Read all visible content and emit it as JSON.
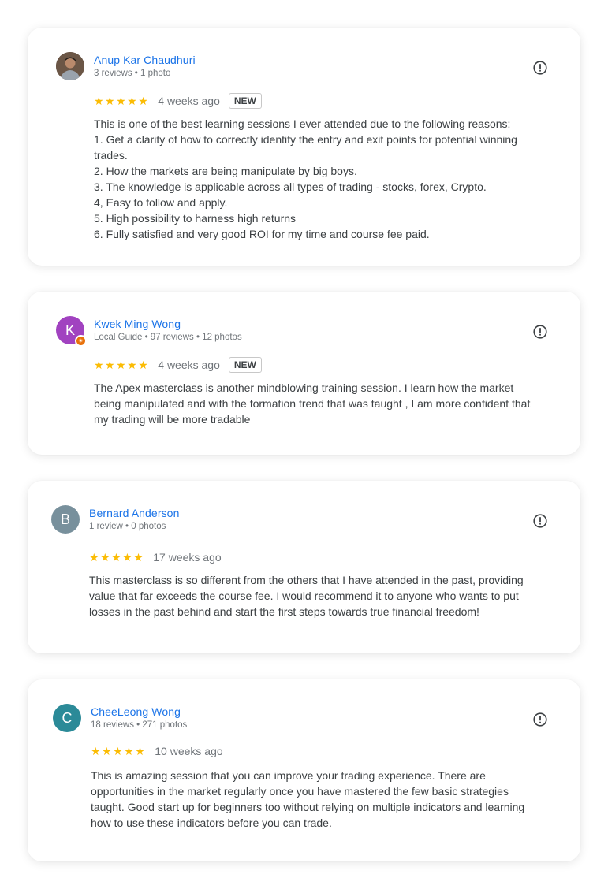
{
  "reviews": [
    {
      "name": "Anup Kar Chaudhuri",
      "meta": "3 reviews • 1 photo",
      "stars": "★★★★★",
      "rating": 5,
      "when": "4 weeks ago",
      "badge": "NEW",
      "avatar": {
        "type": "photo"
      },
      "lines": [
        "This is one of the best learning sessions I ever attended due to the following reasons:",
        "1. Get a clarity of how to correctly identify the entry and exit points for potential winning",
        "trades.",
        "2. How the markets are being manipulate by big boys.",
        "3. The knowledge is applicable across all types of trading - stocks, forex, Crypto.",
        "4, Easy to follow and apply.",
        "5. High possibility to harness high returns",
        "6. Fully satisfied and very good ROI for my time and course fee paid."
      ]
    },
    {
      "name": "Kwek Ming Wong",
      "meta": "Local Guide • 97 reviews • 12 photos",
      "stars": "★★★★★",
      "rating": 5,
      "when": "4 weeks ago",
      "badge": "NEW",
      "avatar": {
        "type": "letter",
        "letter": "K",
        "color": "#a142c0",
        "local_guide_badge": true
      },
      "lines": [
        "The Apex masterclass is another mindblowing training session. I learn how the market",
        "being manipulated and with the formation trend that was taught , I am more confident that",
        "my trading will be more tradable"
      ]
    },
    {
      "name": "Bernard Anderson",
      "meta": "1 review • 0 photos",
      "stars": "★★★★★",
      "rating": 5,
      "when": "17 weeks ago",
      "avatar": {
        "type": "letter",
        "letter": "B",
        "color": "#78909c"
      },
      "lines": [
        "This masterclass is so different from the others that I have attended in the past, providing",
        "value that far exceeds the course fee. I would recommend it to anyone who wants to put",
        "losses in the past behind and start the first steps towards true financial freedom!"
      ]
    },
    {
      "name": "CheeLeong Wong",
      "meta": "18 reviews • 271 photos",
      "stars": "★★★★★",
      "rating": 5,
      "when": "10 weeks ago",
      "avatar": {
        "type": "letter",
        "letter": "C",
        "color": "#2b8a98"
      },
      "lines": [
        "This is amazing session that you can improve your trading experience. There are",
        "opportunities in the market regularly once you have mastered the few basic strategies",
        "taught. Good start up for beginners too without relying on multiple indicators and learning",
        "how to use these indicators before you can trade."
      ]
    }
  ],
  "icons": {
    "flag": "report-flag-icon",
    "star": "star-icon",
    "local_guide": "local-guide-badge-icon"
  },
  "colors": {
    "name_link": "#1a73e8",
    "star": "#fbbc04",
    "meta": "#70757a",
    "text": "#3c4043"
  }
}
